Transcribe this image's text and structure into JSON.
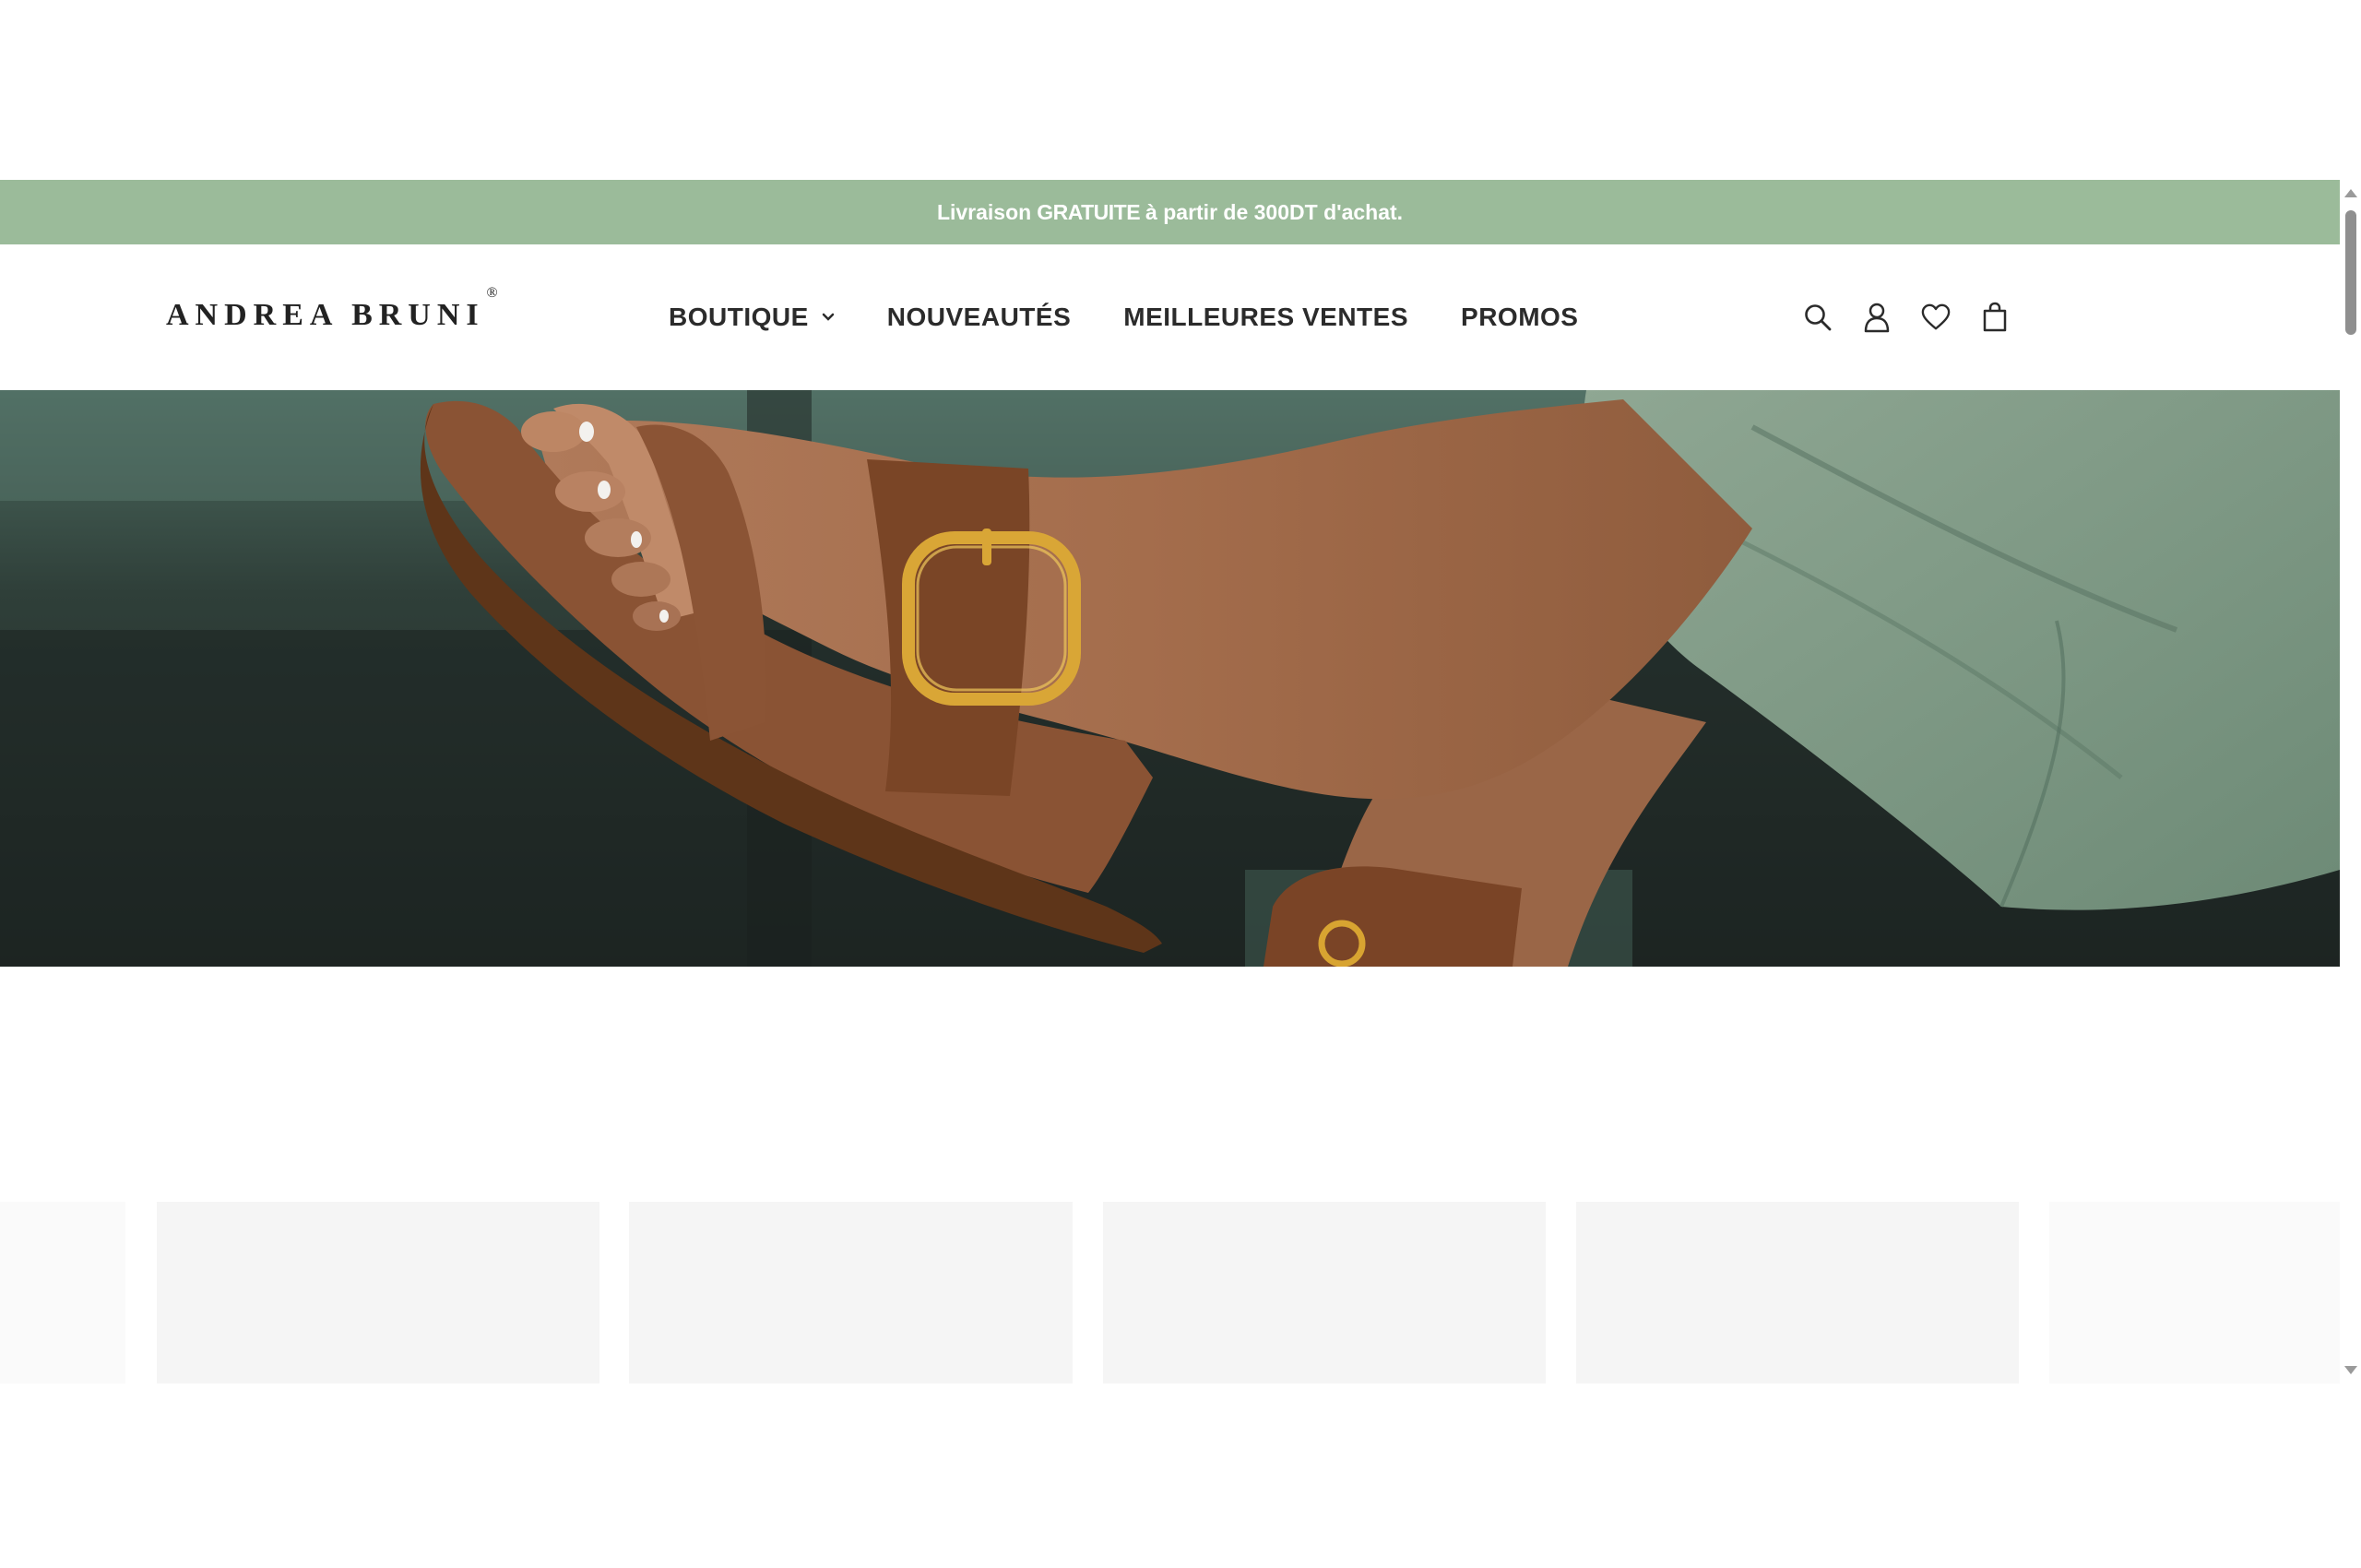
{
  "announcement": {
    "before": "Livraison",
    "emphasis": "GRATUITE",
    "after": "à partir de 300DT d'achat."
  },
  "brand": {
    "name": "ANDREA BRUNI",
    "registered": "®"
  },
  "nav": {
    "items": [
      {
        "label": "BOUTIQUE",
        "has_dropdown": true
      },
      {
        "label": "NOUVEAUTÉS"
      },
      {
        "label": "MEILLEURES VENTES"
      },
      {
        "label": "PROMOS"
      }
    ]
  },
  "header_icons": [
    "search-icon",
    "account-icon",
    "wishlist-heart-icon",
    "shopping-bag-icon"
  ],
  "hero": {
    "image": "leather-sandal-with-gold-buckle"
  },
  "gallery": {
    "tile_count": 6
  },
  "colors": {
    "announcement_bg": "#9bbb9a",
    "text": "#2b2b2b",
    "placeholder": "#f5f5f5"
  }
}
